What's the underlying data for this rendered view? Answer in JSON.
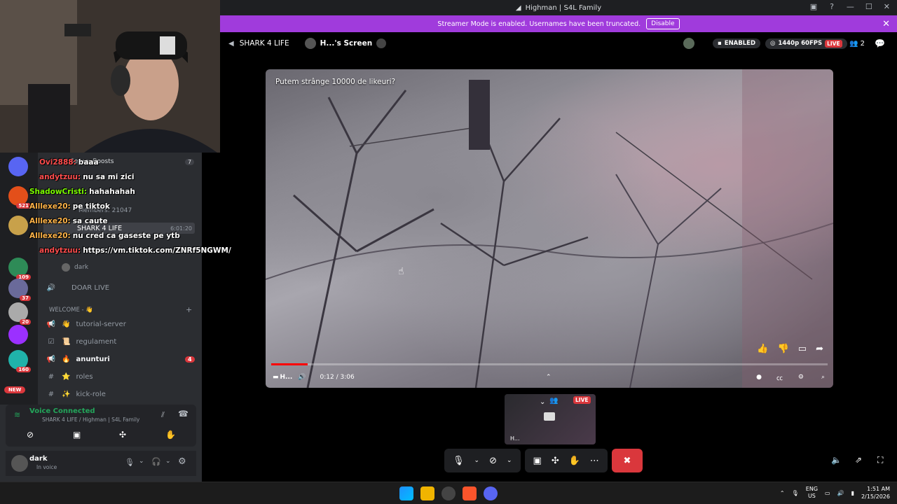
{
  "window": {
    "title": "Highman | S4L Family",
    "icon": "discord-icon"
  },
  "banner": {
    "text": "Streamer Mode is enabled. Usernames have been truncated.",
    "button": "Disable"
  },
  "stage": {
    "server": "SHARK 4 LIFE",
    "screen_label": "H...'s Screen",
    "enabled_label": "ENABLED",
    "quality": "1440p 60FPS",
    "live": "LIVE",
    "viewers": "2"
  },
  "video": {
    "caption": "Putem strânge 10000 de likeuri?",
    "time": "0:12 / 3:06",
    "channel_short": "H...",
    "progress_fraction": 0.065
  },
  "thumbnail": {
    "live": "LIVE",
    "name": "H..."
  },
  "sidebar": {
    "boosts_label": "Server Boosts",
    "boosts_count": "7",
    "members_label": "Members: 21047",
    "voice_channel": "SHARK 4 LIFE",
    "voice_timer": "6:01:20",
    "voice_user_2": "dark",
    "doar_live": "DOAR LIVE",
    "category": "WELCOME - 👋",
    "channels": [
      {
        "name": "tutorial-server",
        "emoji": "👋"
      },
      {
        "name": "regulament",
        "emoji": "📜"
      },
      {
        "name": "anunturi",
        "emoji": "🔥",
        "badge": "4"
      },
      {
        "name": "roles",
        "emoji": "⭐"
      },
      {
        "name": "kick-role",
        "emoji": "✨"
      }
    ],
    "server_badges": [
      "",
      "521",
      "",
      "109",
      "37",
      "20",
      "",
      "160",
      "NEW"
    ]
  },
  "chat": [
    {
      "user": "Ovi2888:",
      "msg": "baaa",
      "color": "#ff4d4d"
    },
    {
      "user": "andytzuu:",
      "msg": "nu sa mi zici",
      "color": "#ff4d4d"
    },
    {
      "user": "ShadowCristi:",
      "msg": "hahahahah",
      "color": "#7cfc00"
    },
    {
      "user": "Alllexe20:",
      "msg": "pe tiktok",
      "color": "#ffb347"
    },
    {
      "user": "Alllexe20:",
      "msg": "sa caute",
      "color": "#ffb347"
    },
    {
      "user": "Alllexe20:",
      "msg": "nu cred ca gaseste pe ytb",
      "color": "#ffb347"
    },
    {
      "user": "andytzuu:",
      "msg": "https://vm.tiktok.com/ZNRf5NGWM/",
      "color": "#ff4d4d"
    }
  ],
  "voice": {
    "status": "Voice Connected",
    "location": "SHARK 4 LIFE / Highman | S4L Family"
  },
  "user": {
    "name": "dark",
    "status": "In voice"
  },
  "taskbar": {
    "lang": "ENG",
    "region": "US",
    "time": "1:51 AM",
    "date": "2/15/2026"
  }
}
